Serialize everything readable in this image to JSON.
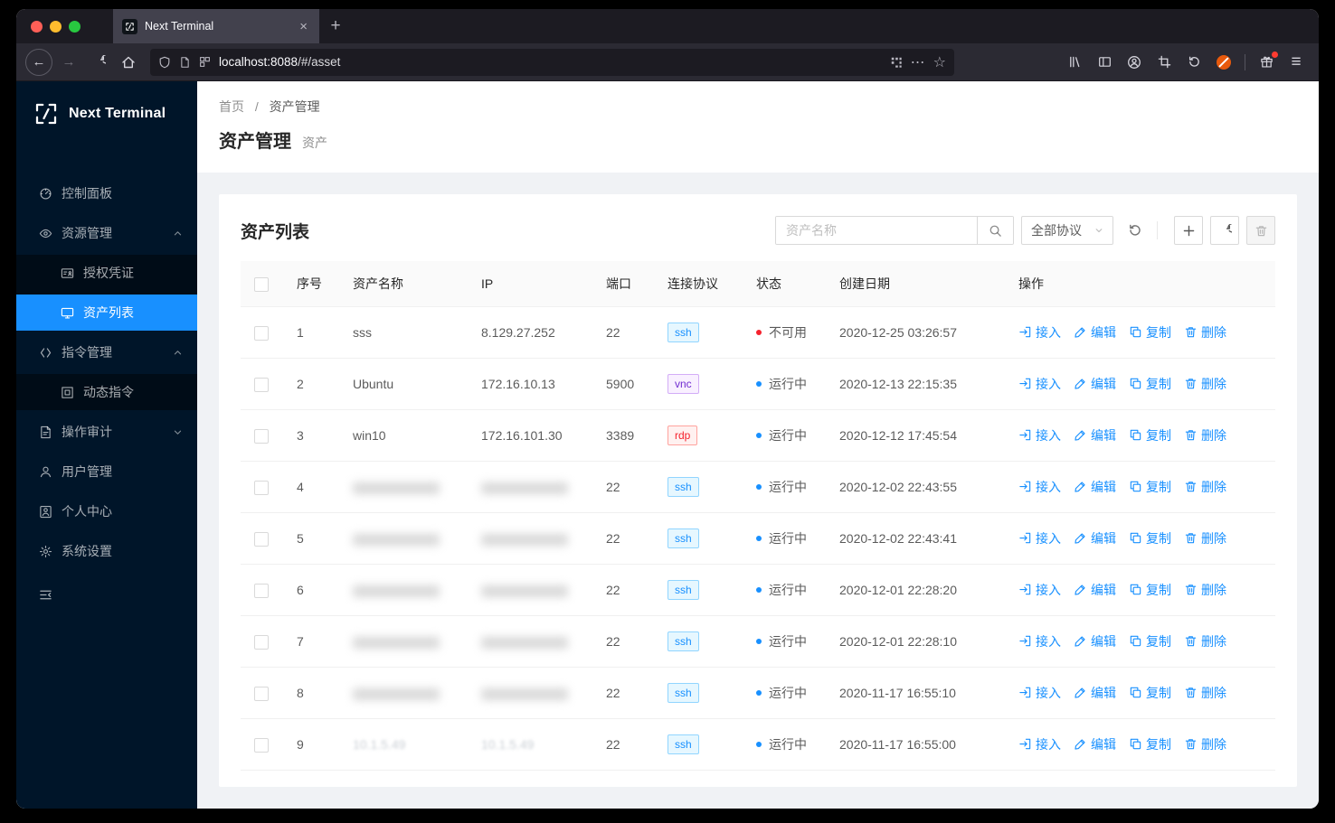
{
  "browser": {
    "tab_title": "Next Terminal",
    "url_host": "localhost:8088",
    "url_path": "/#/asset"
  },
  "sidebar": {
    "logo_text": "Next Terminal",
    "items": [
      {
        "label": "控制面板",
        "icon": "dashboard-icon"
      },
      {
        "label": "资源管理",
        "icon": "resource-icon",
        "caret": "up"
      },
      {
        "label": "授权凭证",
        "icon": "credential-icon",
        "sub": true
      },
      {
        "label": "资产列表",
        "icon": "asset-list-icon",
        "sub": true,
        "active": true
      },
      {
        "label": "指令管理",
        "icon": "command-icon",
        "caret": "up"
      },
      {
        "label": "动态指令",
        "icon": "dynamic-command-icon",
        "sub": true
      },
      {
        "label": "操作审计",
        "icon": "audit-icon",
        "caret": "down"
      },
      {
        "label": "用户管理",
        "icon": "users-icon"
      },
      {
        "label": "个人中心",
        "icon": "profile-icon"
      },
      {
        "label": "系统设置",
        "icon": "settings-icon"
      }
    ]
  },
  "breadcrumb": {
    "home": "首页",
    "separator": "/",
    "current": "资产管理"
  },
  "page": {
    "title": "资产管理",
    "subtitle": "资产"
  },
  "card": {
    "title": "资产列表",
    "search_placeholder": "资产名称",
    "search_value": "",
    "protocol_filter_value": "全部协议"
  },
  "table": {
    "columns": [
      "序号",
      "资产名称",
      "IP",
      "端口",
      "连接协议",
      "状态",
      "创建日期",
      "操作"
    ],
    "action_labels": {
      "access": "接入",
      "edit": "编辑",
      "copy": "复制",
      "delete": "删除"
    },
    "rows": [
      {
        "index": "1",
        "name": "sss",
        "ip": "8.129.27.252",
        "port": "22",
        "protocol": "ssh",
        "status": "不可用",
        "status_type": "error",
        "date": "2020-12-25 03:26:57",
        "masked": false
      },
      {
        "index": "2",
        "name": "Ubuntu",
        "ip": "172.16.10.13",
        "port": "5900",
        "protocol": "vnc",
        "status": "运行中",
        "status_type": "processing",
        "date": "2020-12-13 22:15:35",
        "masked": false
      },
      {
        "index": "3",
        "name": "win10",
        "ip": "172.16.101.30",
        "port": "3389",
        "protocol": "rdp",
        "status": "运行中",
        "status_type": "processing",
        "date": "2020-12-12 17:45:54",
        "masked": false
      },
      {
        "index": "4",
        "name": "",
        "ip": "",
        "port": "22",
        "protocol": "ssh",
        "status": "运行中",
        "status_type": "processing",
        "date": "2020-12-02 22:43:55",
        "masked": true
      },
      {
        "index": "5",
        "name": "",
        "ip": "",
        "port": "22",
        "protocol": "ssh",
        "status": "运行中",
        "status_type": "processing",
        "date": "2020-12-02 22:43:41",
        "masked": true
      },
      {
        "index": "6",
        "name": "",
        "ip": "",
        "port": "22",
        "protocol": "ssh",
        "status": "运行中",
        "status_type": "processing",
        "date": "2020-12-01 22:28:20",
        "masked": true
      },
      {
        "index": "7",
        "name": "",
        "ip": "",
        "port": "22",
        "protocol": "ssh",
        "status": "运行中",
        "status_type": "processing",
        "date": "2020-12-01 22:28:10",
        "masked": true
      },
      {
        "index": "8",
        "name": "",
        "ip": "",
        "port": "22",
        "protocol": "ssh",
        "status": "运行中",
        "status_type": "processing",
        "date": "2020-11-17 16:55:10",
        "masked": true
      },
      {
        "index": "9",
        "name": "10.1.5.49",
        "ip": "10.1.5.49",
        "port": "22",
        "protocol": "ssh",
        "status": "运行中",
        "status_type": "processing",
        "date": "2020-11-17 16:55:00",
        "masked": true
      }
    ]
  },
  "colors": {
    "accent": "#1890ff",
    "sidebar_bg": "#001529",
    "status_error": "#f5222d",
    "status_processing": "#1890ff",
    "tag_ssh": "#1890ff",
    "tag_vnc": "#722ed1",
    "tag_rdp": "#f5222d"
  }
}
